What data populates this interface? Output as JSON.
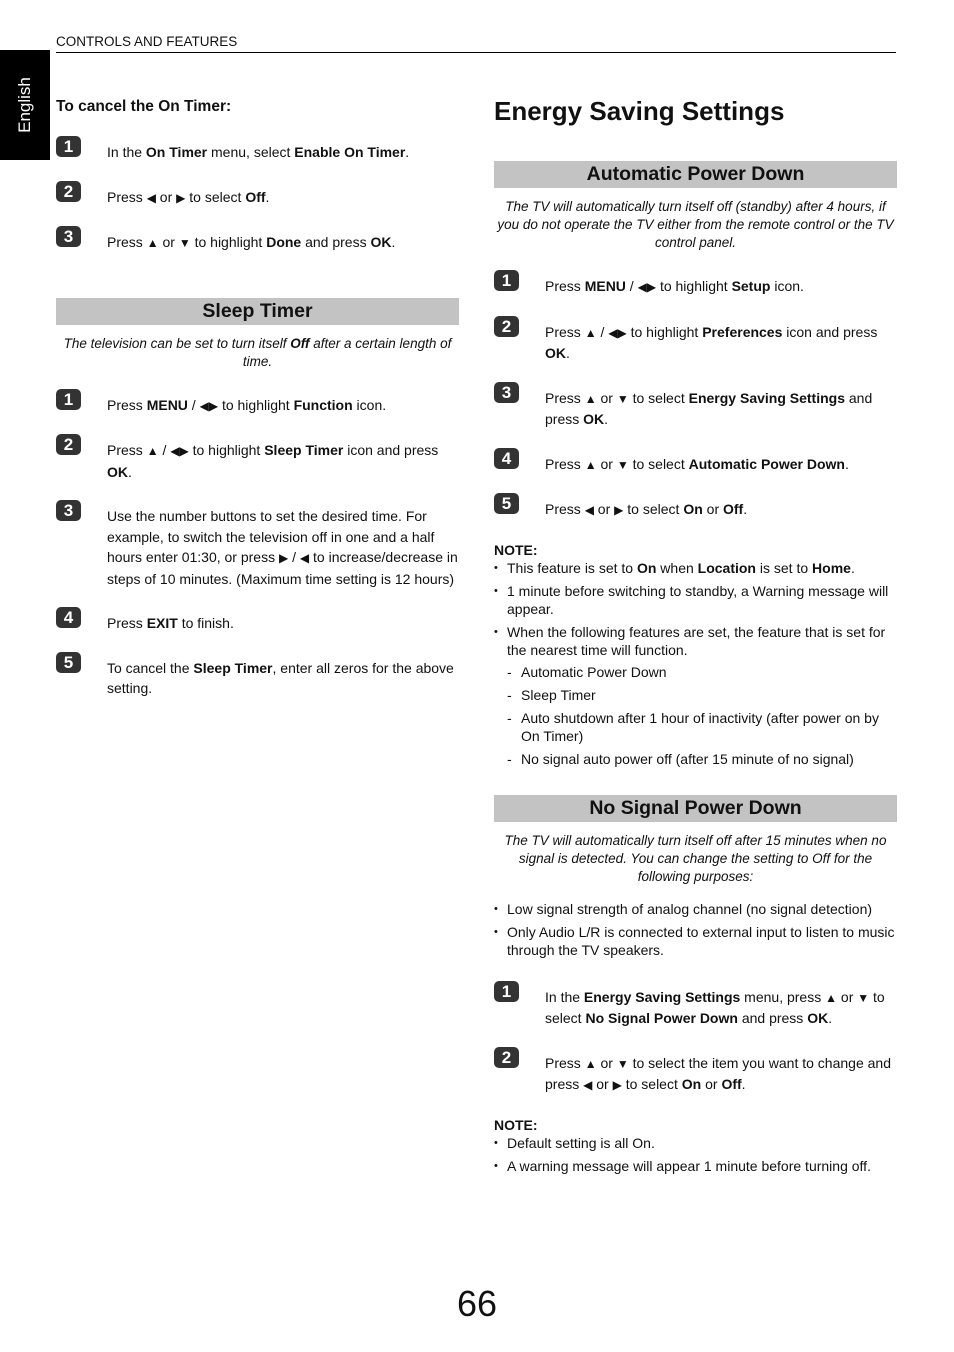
{
  "header": {
    "section": "CONTROLS AND FEATURES",
    "language_tab": "English"
  },
  "left": {
    "cancel_on_timer": {
      "title": "To cancel the On Timer:",
      "steps": [
        {
          "num": "1",
          "parts": [
            [
              "In the ",
              false
            ],
            [
              "On Timer",
              true
            ],
            [
              " menu, select ",
              false
            ],
            [
              "Enable On Timer",
              true
            ],
            [
              ".",
              false
            ]
          ]
        },
        {
          "num": "2",
          "parts": [
            [
              "Press ",
              false
            ],
            [
              "◀",
              "icon"
            ],
            [
              " or ",
              false
            ],
            [
              "▶",
              "icon"
            ],
            [
              " to select ",
              false
            ],
            [
              "Off",
              true
            ],
            [
              ".",
              false
            ]
          ]
        },
        {
          "num": "3",
          "parts": [
            [
              "Press ",
              false
            ],
            [
              "▲",
              "icon"
            ],
            [
              " or ",
              false
            ],
            [
              "▼",
              "icon"
            ],
            [
              " to highlight ",
              false
            ],
            [
              "Done",
              true
            ],
            [
              " and press ",
              false
            ],
            [
              "OK",
              true
            ],
            [
              ".",
              false
            ]
          ]
        }
      ]
    },
    "sleep_timer": {
      "title": "Sleep Timer",
      "intro_parts": [
        [
          "The television can be set to turn itself ",
          false
        ],
        [
          "Off",
          true
        ],
        [
          " after a certain length of time.",
          false
        ]
      ],
      "steps": [
        {
          "num": "1",
          "parts": [
            [
              "Press ",
              false
            ],
            [
              "MENU",
              true
            ],
            [
              " / ",
              false
            ],
            [
              "◀▶",
              "icon"
            ],
            [
              " to highlight ",
              false
            ],
            [
              "Function",
              true
            ],
            [
              " icon.",
              false
            ]
          ]
        },
        {
          "num": "2",
          "parts": [
            [
              "Press ",
              false
            ],
            [
              "▲",
              "icon"
            ],
            [
              " / ",
              false
            ],
            [
              "◀▶",
              "icon"
            ],
            [
              " to highlight ",
              false
            ],
            [
              "Sleep Timer",
              true
            ],
            [
              " icon and press ",
              false
            ],
            [
              "OK",
              true
            ],
            [
              ".",
              false
            ]
          ]
        },
        {
          "num": "3",
          "parts": [
            [
              "Use the number buttons to set the desired time. For example, to switch the television off in one and a half hours enter 01:30, or press ",
              false
            ],
            [
              "▶",
              "icon"
            ],
            [
              " / ",
              false
            ],
            [
              "◀",
              "icon"
            ],
            [
              " to increase/decrease in steps of 10 minutes. (Maximum time setting is 12 hours)",
              false
            ]
          ]
        },
        {
          "num": "4",
          "parts": [
            [
              "Press ",
              false
            ],
            [
              "EXIT",
              true
            ],
            [
              " to finish.",
              false
            ]
          ]
        },
        {
          "num": "5",
          "parts": [
            [
              "To cancel the ",
              false
            ],
            [
              "Sleep Timer",
              true
            ],
            [
              ", enter all zeros for the above setting.",
              false
            ]
          ]
        }
      ]
    }
  },
  "right": {
    "title": "Energy Saving Settings",
    "auto_power_down": {
      "title": "Automatic Power Down",
      "intro": "The TV will automatically turn itself off (standby) after 4 hours, if you do not operate the TV either from the remote control or the TV control panel.",
      "steps": [
        {
          "num": "1",
          "parts": [
            [
              "Press ",
              false
            ],
            [
              "MENU",
              true
            ],
            [
              " / ",
              false
            ],
            [
              "◀▶",
              "icon"
            ],
            [
              " to highlight ",
              false
            ],
            [
              "Setup",
              true
            ],
            [
              " icon.",
              false
            ]
          ]
        },
        {
          "num": "2",
          "parts": [
            [
              "Press ",
              false
            ],
            [
              "▲",
              "icon"
            ],
            [
              " / ",
              false
            ],
            [
              "◀▶",
              "icon"
            ],
            [
              " to highlight ",
              false
            ],
            [
              "Preferences",
              true
            ],
            [
              " icon and press ",
              false
            ],
            [
              "OK",
              true
            ],
            [
              ".",
              false
            ]
          ]
        },
        {
          "num": "3",
          "parts": [
            [
              "Press ",
              false
            ],
            [
              "▲",
              "icon"
            ],
            [
              " or ",
              false
            ],
            [
              "▼",
              "icon"
            ],
            [
              " to select ",
              false
            ],
            [
              "Energy Saving Settings",
              true
            ],
            [
              " and press ",
              false
            ],
            [
              "OK",
              true
            ],
            [
              ".",
              false
            ]
          ]
        },
        {
          "num": "4",
          "parts": [
            [
              "Press ",
              false
            ],
            [
              "▲",
              "icon"
            ],
            [
              " or ",
              false
            ],
            [
              "▼",
              "icon"
            ],
            [
              " to select ",
              false
            ],
            [
              "Automatic Power Down",
              true
            ],
            [
              ".",
              false
            ]
          ]
        },
        {
          "num": "5",
          "parts": [
            [
              "Press ",
              false
            ],
            [
              "◀",
              "icon"
            ],
            [
              " or ",
              false
            ],
            [
              "▶",
              "icon"
            ],
            [
              " to select ",
              false
            ],
            [
              "On",
              true
            ],
            [
              " or ",
              false
            ],
            [
              "Off",
              true
            ],
            [
              ".",
              false
            ]
          ]
        }
      ],
      "note_label": "NOTE:",
      "notes": [
        {
          "parts": [
            [
              "This feature is set to ",
              false
            ],
            [
              "On",
              true
            ],
            [
              " when ",
              false
            ],
            [
              "Location",
              true
            ],
            [
              " is set to ",
              false
            ],
            [
              "Home",
              true
            ],
            [
              ".",
              false
            ]
          ]
        },
        {
          "parts": [
            [
              "1 minute before switching to standby, a Warning message will appear.",
              false
            ]
          ]
        },
        {
          "parts": [
            [
              "When the following features are set, the feature that is set for the nearest time will function.",
              false
            ]
          ],
          "subs": [
            "Automatic Power Down",
            "Sleep Timer",
            "Auto shutdown after 1 hour of inactivity (after power on by On Timer)",
            "No signal auto power off (after 15 minute of no signal)"
          ]
        }
      ]
    },
    "no_signal": {
      "title": "No Signal Power Down",
      "intro": "The TV will automatically turn itself off after 15 minutes when no signal is detected. You can change the setting to Off for the following purposes:",
      "bullets": [
        "Low signal strength of analog channel (no signal detection)",
        "Only Audio L/R is connected to external input to listen to music through the TV speakers."
      ],
      "steps": [
        {
          "num": "1",
          "parts": [
            [
              "In the ",
              false
            ],
            [
              "Energy Saving Settings",
              true
            ],
            [
              " menu, press ",
              false
            ],
            [
              "▲",
              "icon"
            ],
            [
              " or ",
              false
            ],
            [
              "▼",
              "icon"
            ],
            [
              " to select ",
              false
            ],
            [
              "No Signal Power Down",
              true
            ],
            [
              " and press ",
              false
            ],
            [
              "OK",
              true
            ],
            [
              ".",
              false
            ]
          ]
        },
        {
          "num": "2",
          "parts": [
            [
              "Press ",
              false
            ],
            [
              "▲",
              "icon"
            ],
            [
              " or ",
              false
            ],
            [
              "▼",
              "icon"
            ],
            [
              " to select the item you want to change and press ",
              false
            ],
            [
              "◀",
              "icon"
            ],
            [
              " or ",
              false
            ],
            [
              "▶",
              "icon"
            ],
            [
              " to select ",
              false
            ],
            [
              "On",
              true
            ],
            [
              " or ",
              false
            ],
            [
              "Off",
              true
            ],
            [
              ".",
              false
            ]
          ]
        }
      ],
      "note_label": "NOTE:",
      "notes": [
        "Default setting is all On.",
        "A warning message will appear 1 minute before turning off."
      ]
    }
  },
  "page_number": "66"
}
